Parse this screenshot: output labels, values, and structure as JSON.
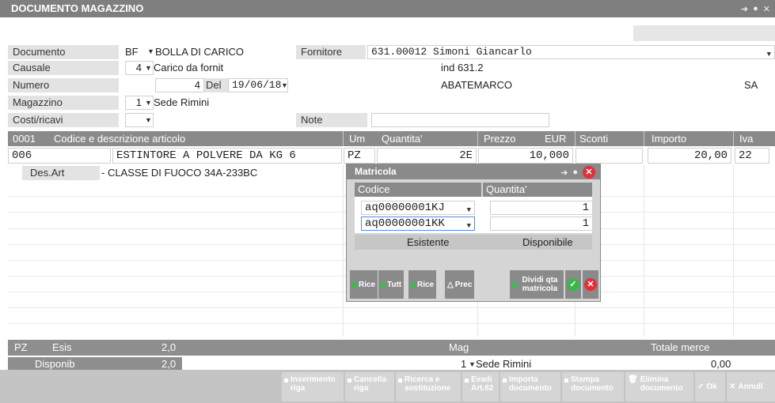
{
  "window": {
    "title": "DOCUMENTO MAGAZZINO"
  },
  "form": {
    "documento_label": "Documento",
    "documento_code": "BF",
    "documento_desc": "BOLLA DI CARICO",
    "fornitore_label": "Fornitore",
    "fornitore_value": "631.00012 Simoni Giancarlo",
    "causale_label": "Causale",
    "causale_code": "4",
    "causale_desc": "Carico da fornit",
    "fornitore_ind": "ind 631.2",
    "fornitore_city": "ABATEMARCO",
    "fornitore_prov": "SA",
    "numero_label": "Numero",
    "numero_value": "4",
    "del_label": "Del",
    "del_value": "19/06/18",
    "magazzino_label": "Magazzino",
    "magazzino_code": "1",
    "magazzino_desc": "Sede Rimini",
    "costi_label": "Costi/ricavi",
    "note_label": "Note",
    "note_value": ""
  },
  "grid": {
    "headers": {
      "row": "0001",
      "codice": "Codice e descrizione articolo",
      "um": "Um",
      "quantita": "Quantita'",
      "prezzo": "Prezzo",
      "valuta": "EUR",
      "sconti": "Sconti",
      "importo": "Importo",
      "iva": "Iva"
    },
    "row": {
      "codice": "006",
      "descrizione": "ESTINTORE A POLVERE DA KG 6",
      "um": "PZ",
      "quantita": "2E",
      "prezzo": "10,000",
      "sconti": "",
      "importo": "20,00",
      "iva": "22"
    },
    "desart_label": "Des.Art",
    "desart_value": "- CLASSE DI FUOCO 34A-233BC"
  },
  "popup": {
    "title": "Matricola",
    "col_codice": "Codice",
    "col_quantita": "Quantita'",
    "rows": [
      {
        "codice": "aq00000001KJ",
        "quantita": "1"
      },
      {
        "codice": "aq00000001KK",
        "quantita": "1"
      }
    ],
    "esistente": "Esistente",
    "disponibile": "Disponibile",
    "buttons": {
      "rice1": "Rice",
      "tutt": "Tutt",
      "rice2": "Rice",
      "prec": "Prec",
      "dividi": "Dividi qta matricola"
    }
  },
  "footer": {
    "um": "PZ",
    "esis_label": "Esis",
    "esis_value": "2,0",
    "mag_label": "Mag",
    "totale_label": "Totale merce",
    "disponib_label": "Disponib",
    "disponib_value": "2,0",
    "mag_code": "1",
    "mag_desc": "Sede Rimini",
    "totale_value": "0,00"
  },
  "toolbar": {
    "inserimento": "Inserimento riga",
    "cancella": "Cancella riga",
    "ricerca": "Ricerca e sostituzione",
    "evadi": "Evadi Art.62",
    "importa": "Importa documento",
    "stampa": "Stampa documento",
    "elimina": "Elimina documento",
    "ok": "Ok",
    "annulla": "Annull"
  },
  "colors": {
    "header_gray": "#8a8a8a",
    "title_gray": "#7f7f7f",
    "label_bg": "#e3e3e3",
    "close_red": "#e0313a",
    "ok_green": "#38b84a"
  }
}
